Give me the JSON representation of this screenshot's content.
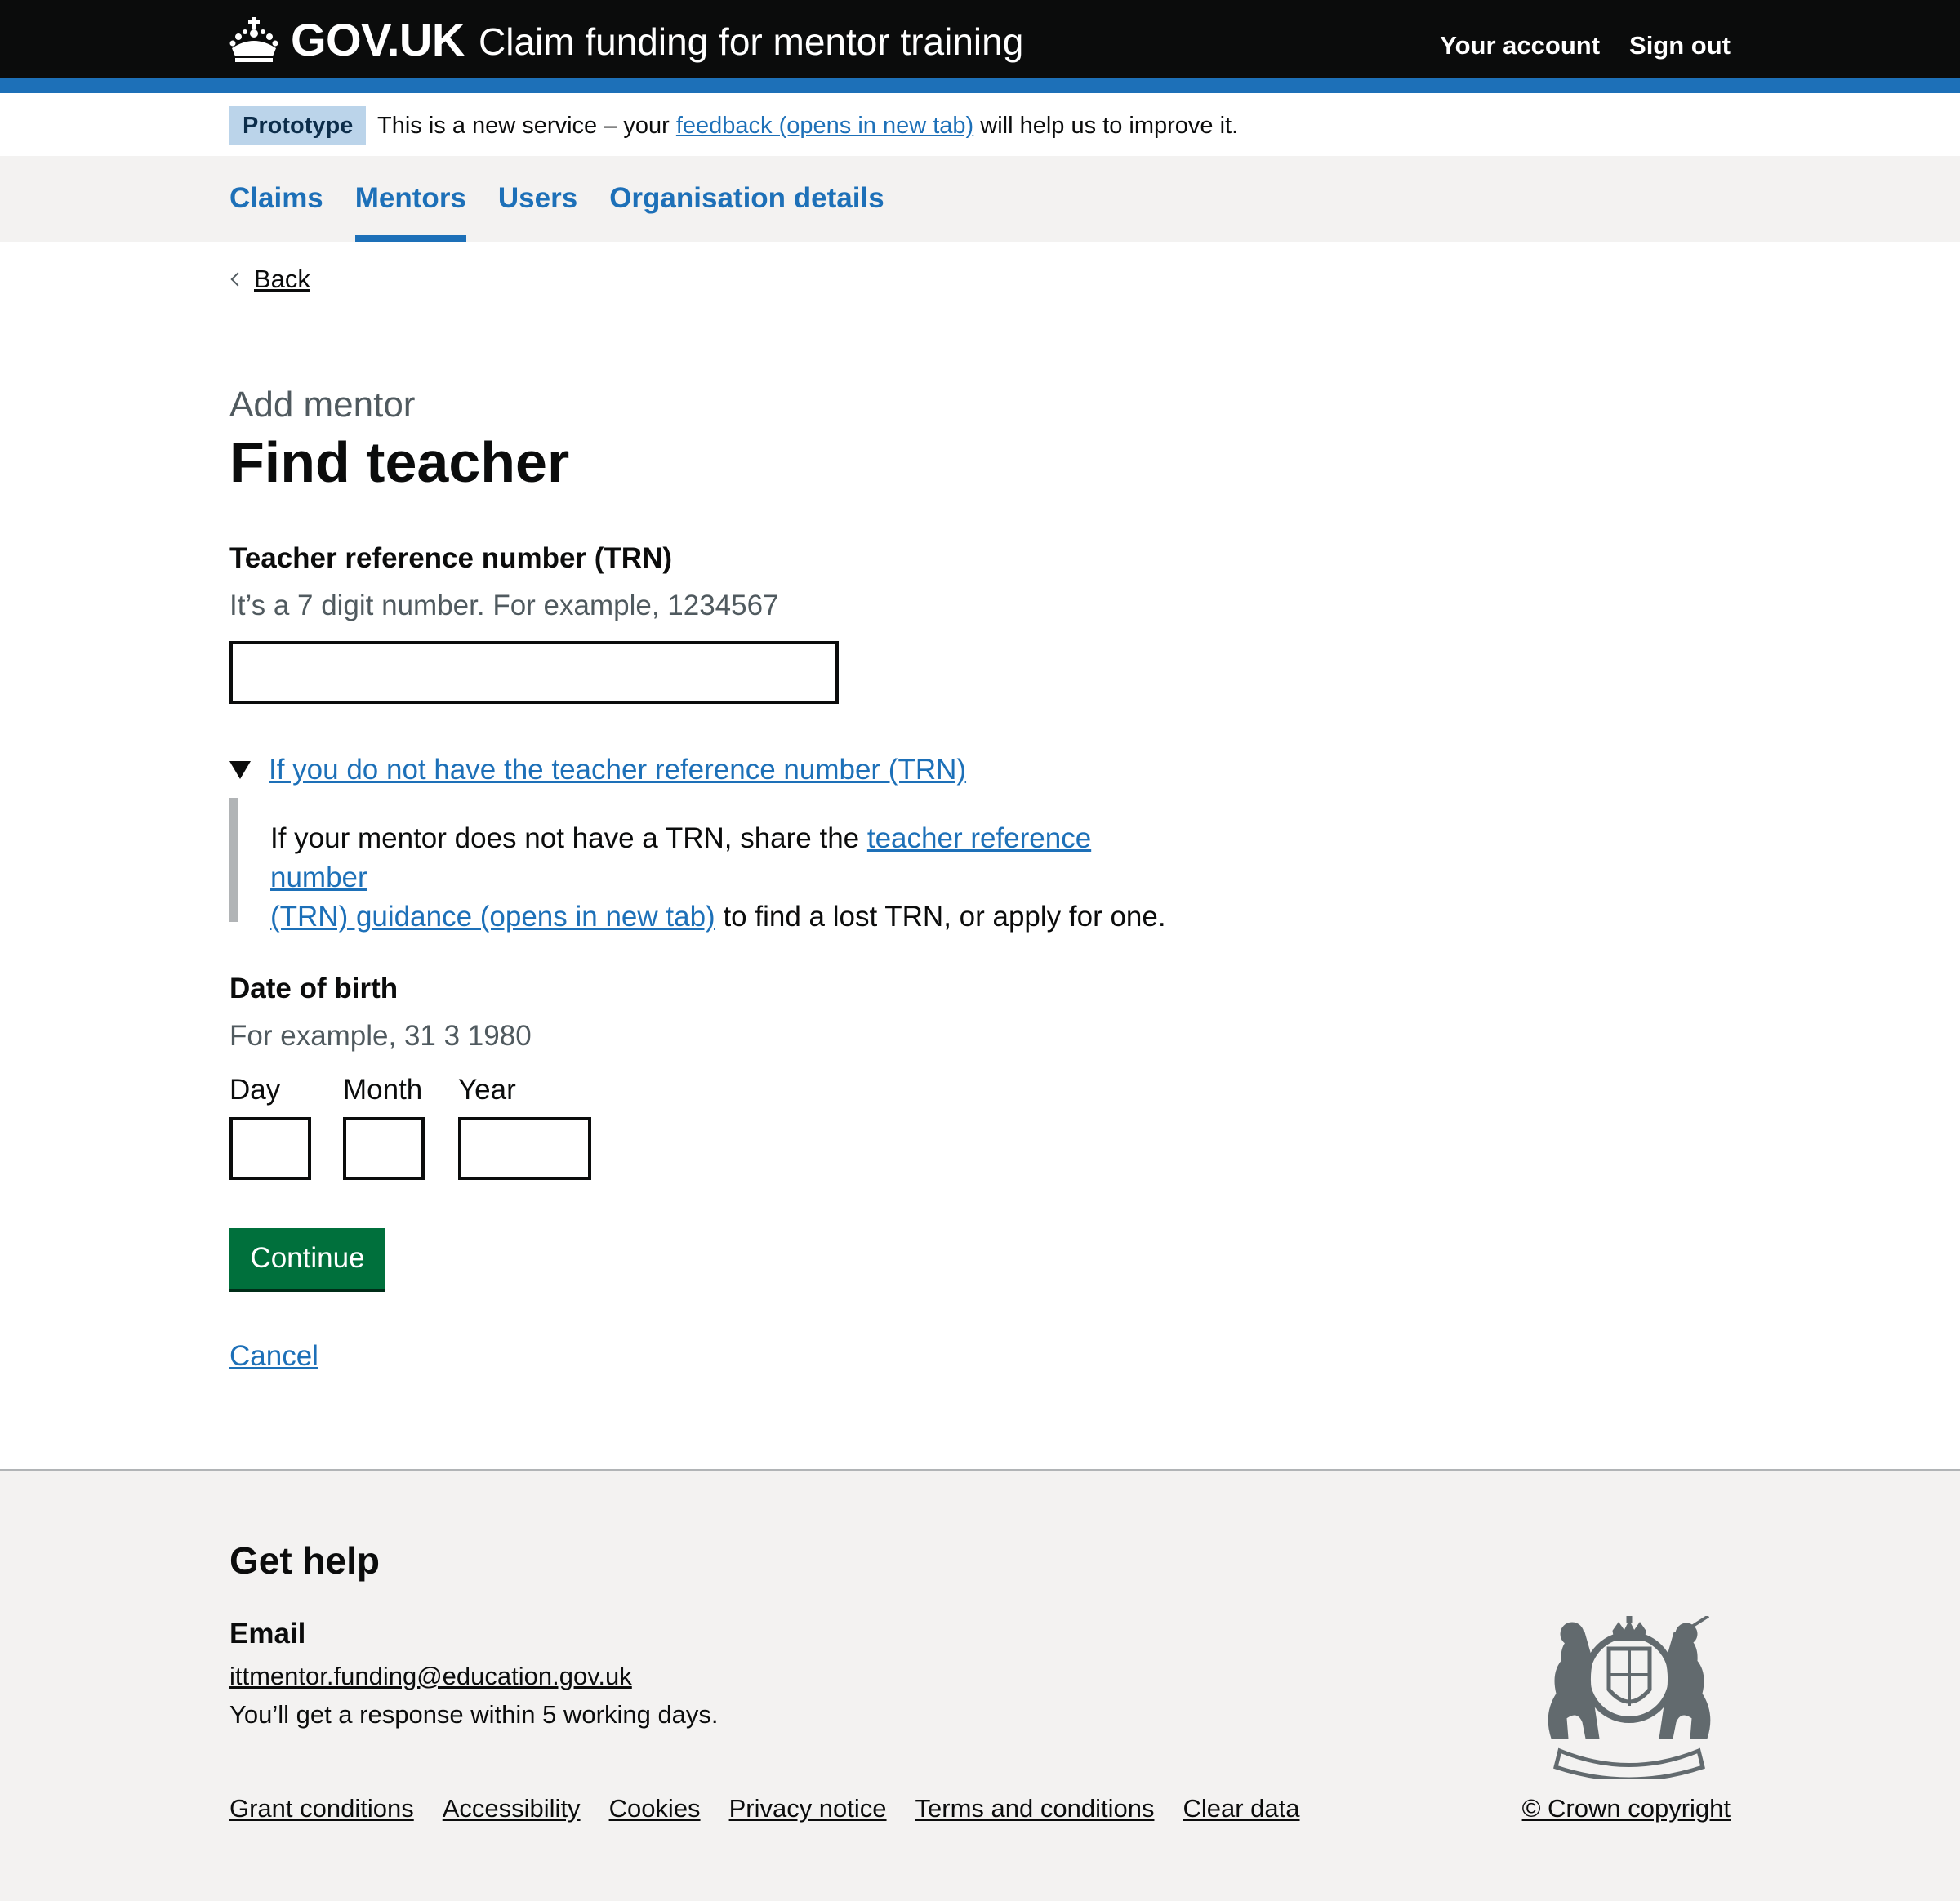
{
  "header": {
    "logo_text": "GOV.UK",
    "service_name": "Claim funding for mentor training",
    "nav": [
      {
        "label": "Your account"
      },
      {
        "label": "Sign out"
      }
    ]
  },
  "phase_banner": {
    "tag": "Prototype",
    "text_before": "This is a new service – your ",
    "link": "feedback (opens in new tab)",
    "text_after": " will help us to improve it."
  },
  "primary_nav": {
    "items": [
      {
        "label": "Claims",
        "active": false
      },
      {
        "label": "Mentors",
        "active": true
      },
      {
        "label": "Users",
        "active": false
      },
      {
        "label": "Organisation details",
        "active": false
      }
    ]
  },
  "back": {
    "label": "Back"
  },
  "page": {
    "caption": "Add mentor",
    "title": "Find teacher"
  },
  "trn": {
    "label": "Teacher reference number (TRN)",
    "hint": "It’s a 7 digit number. For example, 1234567",
    "value": ""
  },
  "details": {
    "summary": "If you do not have the teacher reference number (TRN)",
    "text_before": "If your mentor does not have a TRN, share the ",
    "link_line1": "teacher reference number",
    "link_line2": "(TRN) guidance (opens in new tab)",
    "text_after": " to find a lost TRN, or apply for one."
  },
  "dob": {
    "label": "Date of birth",
    "hint": "For example, 31 3 1980",
    "day_label": "Day",
    "month_label": "Month",
    "year_label": "Year",
    "day_value": "",
    "month_value": "",
    "year_value": ""
  },
  "actions": {
    "continue_label": "Continue",
    "cancel_label": "Cancel"
  },
  "footer": {
    "heading": "Get help",
    "email_heading": "Email",
    "email": "ittmentor.funding@education.gov.uk",
    "response": "You’ll get a response within 5 working days.",
    "links": [
      {
        "label": "Grant conditions"
      },
      {
        "label": "Accessibility"
      },
      {
        "label": "Cookies"
      },
      {
        "label": "Privacy notice"
      },
      {
        "label": "Terms and conditions"
      },
      {
        "label": "Clear data"
      }
    ],
    "copyright": "© Crown copyright"
  },
  "colors": {
    "header_bg": "#0b0c0c",
    "brand_blue": "#1d70b8",
    "button_green": "#00703c",
    "footer_bg": "#f3f2f1",
    "hint_grey": "#505a5f"
  },
  "icons": {
    "logo": "crown-icon",
    "back": "chevron-left-icon",
    "details": "triangle-down-icon",
    "footer": "royal-crest-icon"
  }
}
